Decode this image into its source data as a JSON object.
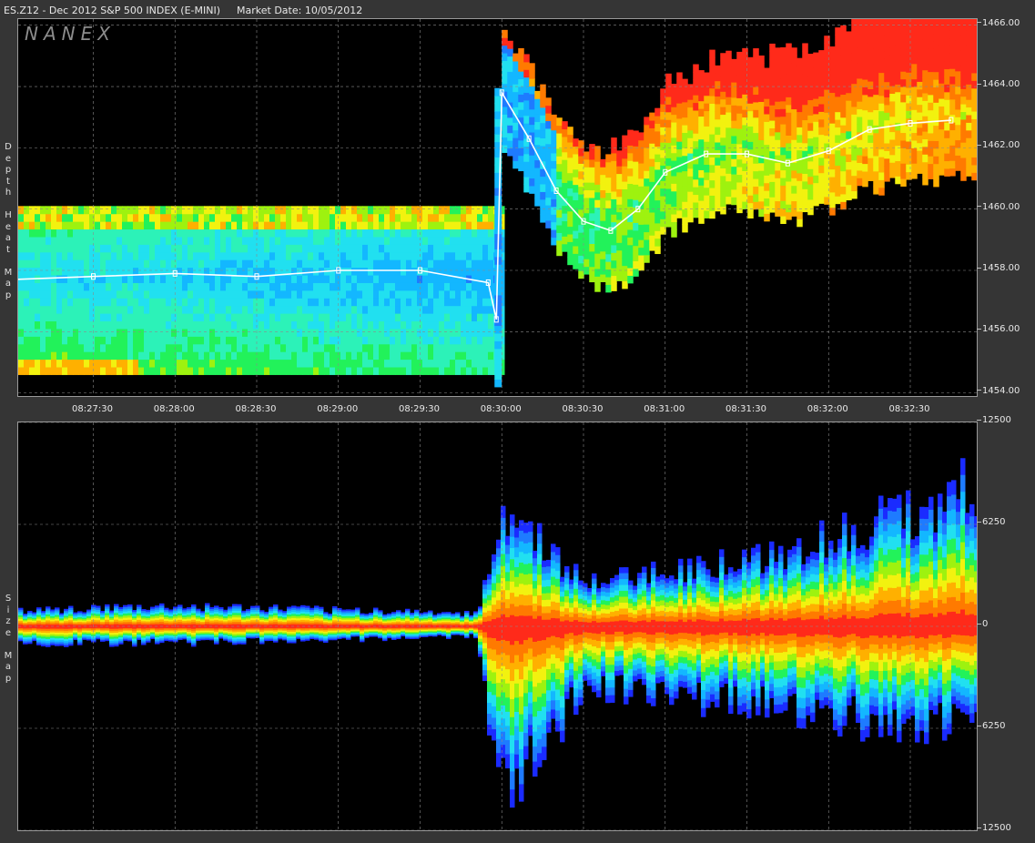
{
  "title": {
    "symbol": "ES.Z12 - Dec 2012 S&P 500 INDEX (E-MINI)",
    "market_date": "Market Date: 10/05/2012"
  },
  "logo": "NANEX",
  "top_chart_label": [
    "D",
    "e",
    "p",
    "t",
    "h",
    "",
    "H",
    "e",
    "a",
    "t",
    "",
    "M",
    "a",
    "p"
  ],
  "bottom_chart_label": [
    "S",
    "i",
    "z",
    "e",
    "",
    "M",
    "a",
    "p"
  ],
  "colors": {
    "background": "#353535",
    "plot_bg": "#000000",
    "heat_scale": [
      "#1a2bff",
      "#1e7bff",
      "#13b7ff",
      "#21e0f0",
      "#2cf2b8",
      "#22f25a",
      "#9ef20f",
      "#f2f20f",
      "#ffb000",
      "#ff7a00",
      "#ff2a1a"
    ]
  },
  "chart_data": [
    {
      "type": "heatmap",
      "name_shown": "Depth Heat Map",
      "x_ticks": [
        "08:27:30",
        "08:28:00",
        "08:28:30",
        "08:29:00",
        "08:29:30",
        "08:30:00",
        "08:30:30",
        "08:31:00",
        "08:31:30",
        "08:32:00",
        "08:32:30"
      ],
      "x_range_minutes": [
        8.4472,
        8.5472
      ],
      "y_ticks": [
        "1466.00",
        "1464.00",
        "1462.00",
        "1460.00",
        "1458.00",
        "1456.00",
        "1454.00"
      ],
      "ylim": [
        1453.9,
        1466.2
      ],
      "trade_price_series": [
        {
          "t": "08:27:00",
          "p": 1457.7
        },
        {
          "t": "08:27:30",
          "p": 1457.8
        },
        {
          "t": "08:28:00",
          "p": 1457.9
        },
        {
          "t": "08:28:30",
          "p": 1457.8
        },
        {
          "t": "08:29:00",
          "p": 1458.0
        },
        {
          "t": "08:29:30",
          "p": 1458.0
        },
        {
          "t": "08:29:55",
          "p": 1457.6
        },
        {
          "t": "08:29:58",
          "p": 1456.4
        },
        {
          "t": "08:30:00",
          "p": 1463.8
        },
        {
          "t": "08:30:10",
          "p": 1462.3
        },
        {
          "t": "08:30:20",
          "p": 1460.6
        },
        {
          "t": "08:30:30",
          "p": 1459.6
        },
        {
          "t": "08:30:40",
          "p": 1459.3
        },
        {
          "t": "08:30:50",
          "p": 1460.0
        },
        {
          "t": "08:31:00",
          "p": 1461.2
        },
        {
          "t": "08:31:15",
          "p": 1461.8
        },
        {
          "t": "08:31:30",
          "p": 1461.8
        },
        {
          "t": "08:31:45",
          "p": 1461.5
        },
        {
          "t": "08:32:00",
          "p": 1461.9
        },
        {
          "t": "08:32:15",
          "p": 1462.6
        },
        {
          "t": "08:32:30",
          "p": 1462.8
        },
        {
          "t": "08:32:45",
          "p": 1462.9
        }
      ],
      "grid": true
    },
    {
      "type": "area",
      "name_shown": "Size Map",
      "y_ticks": [
        "12500",
        "6250",
        "0",
        "6250",
        "12500"
      ],
      "ylim": [
        -12500,
        12500
      ],
      "spread_envelope": [
        {
          "t": "08:27:00",
          "upper": 1000,
          "lower": -1000
        },
        {
          "t": "08:28:00",
          "upper": 1200,
          "lower": -1000
        },
        {
          "t": "08:29:00",
          "upper": 1000,
          "lower": -800
        },
        {
          "t": "08:29:50",
          "upper": 800,
          "lower": -600
        },
        {
          "t": "08:30:00",
          "upper": 7200,
          "lower": -11000
        },
        {
          "t": "08:30:30",
          "upper": 2500,
          "lower": -3500
        },
        {
          "t": "08:31:00",
          "upper": 3500,
          "lower": -4500
        },
        {
          "t": "08:31:30",
          "upper": 4000,
          "lower": -4500
        },
        {
          "t": "08:32:00",
          "upper": 5500,
          "lower": -5500
        },
        {
          "t": "08:32:30",
          "upper": 7000,
          "lower": -6000
        },
        {
          "t": "08:32:50",
          "upper": 8500,
          "lower": -5500
        }
      ],
      "grid": true
    }
  ]
}
